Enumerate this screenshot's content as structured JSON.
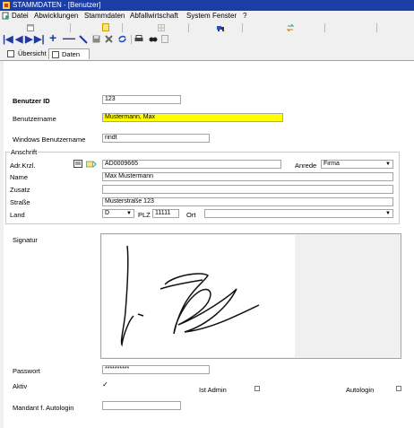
{
  "window": {
    "title": "STAMMDATEN - [Benutzer]"
  },
  "menu": [
    "Datei",
    "Abwicklungen",
    "Stammdaten",
    "Abfallwirtschaft",
    "System",
    "Fenster",
    "?"
  ],
  "toolbar": {
    "nav_icons": [
      "first-record-icon",
      "prev-record-icon",
      "next-record-icon",
      "last-record-icon",
      "add-record-icon",
      "delete-record-icon",
      "edit-record-icon",
      "save-icon",
      "cancel-icon",
      "refresh-icon",
      "print-icon",
      "search-icon",
      "filter-icon"
    ]
  },
  "tabs": [
    {
      "label": "Übersicht"
    },
    {
      "label": "Daten"
    }
  ],
  "form": {
    "benutzer_id": {
      "label": "Benutzer ID",
      "value": "123"
    },
    "benutzername": {
      "label": "Benutzername",
      "value": "Mustermann, Max"
    },
    "windows_benutzername": {
      "label": "Windows Benutzername",
      "value": "rindt"
    },
    "anschrift": {
      "legend": "Anschrift",
      "adr_krzl": {
        "label": "Adr.Krzl.",
        "value": "AD0009665"
      },
      "anrede": {
        "label": "Anrede",
        "value": "Firma"
      },
      "name": {
        "label": "Name",
        "value": "Max Mustermann"
      },
      "zusatz": {
        "label": "Zusatz",
        "value": ""
      },
      "strasse": {
        "label": "Straße",
        "value": "Musterstraße 123"
      },
      "land": {
        "label": "Land",
        "value": "D"
      },
      "plz": {
        "label": "PLZ",
        "value": "11111"
      },
      "ort": {
        "label": "Ort",
        "value": ""
      }
    },
    "signatur": {
      "label": "Signatur"
    },
    "passwort": {
      "label": "Passwort",
      "value": "**********"
    },
    "aktiv": {
      "label": "Aktiv",
      "checked": true
    },
    "ist_admin": {
      "label": "Ist Admin",
      "checked": false
    },
    "autologin": {
      "label": "Autologin",
      "checked": false
    },
    "mandant_autologin": {
      "label": "Mandant f. Autologin",
      "value": ""
    }
  },
  "colors": {
    "title_bar": "#1a3da6",
    "highlight_field": "#ffff00",
    "nav_arrow": "#1f3a9c",
    "add": "#1f4fd0",
    "delete": "#1f4fd0"
  }
}
